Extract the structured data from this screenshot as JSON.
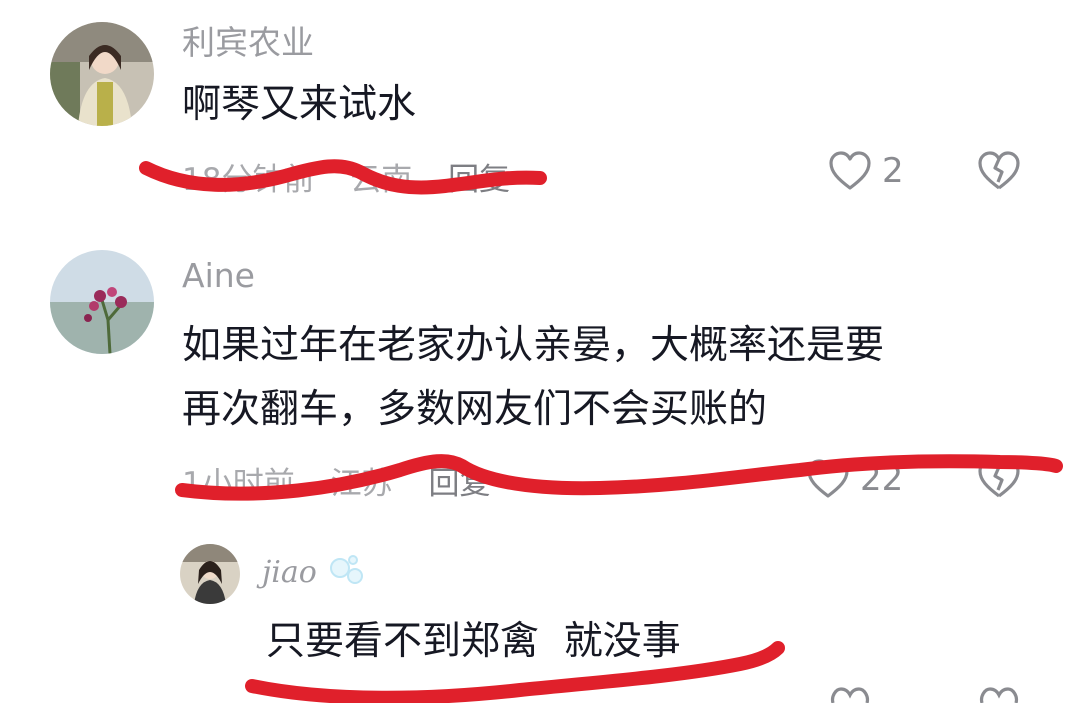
{
  "comments": [
    {
      "username": "利宾农业",
      "text_lines": [
        "啊琴又来试水"
      ],
      "time": "18分钟前",
      "location": "云南",
      "reply_label": "回复",
      "likes": "2"
    },
    {
      "username": "Aine",
      "text_lines": [
        "如果过年在老家办认亲晏，大概率还是要",
        "再次翻车，多数网友们不会买账的"
      ],
      "time": "1小时前",
      "location": "江苏",
      "reply_label": "回复",
      "likes": "22"
    }
  ],
  "reply": {
    "username": "jiao",
    "text": "只要看不到郑禽  就没事"
  },
  "icons": {
    "like": "heart-outline-icon",
    "dislike": "broken-heart-icon"
  },
  "colors": {
    "scribble": "#e0202b",
    "meta": "#a8a9ad",
    "text": "#161823"
  }
}
